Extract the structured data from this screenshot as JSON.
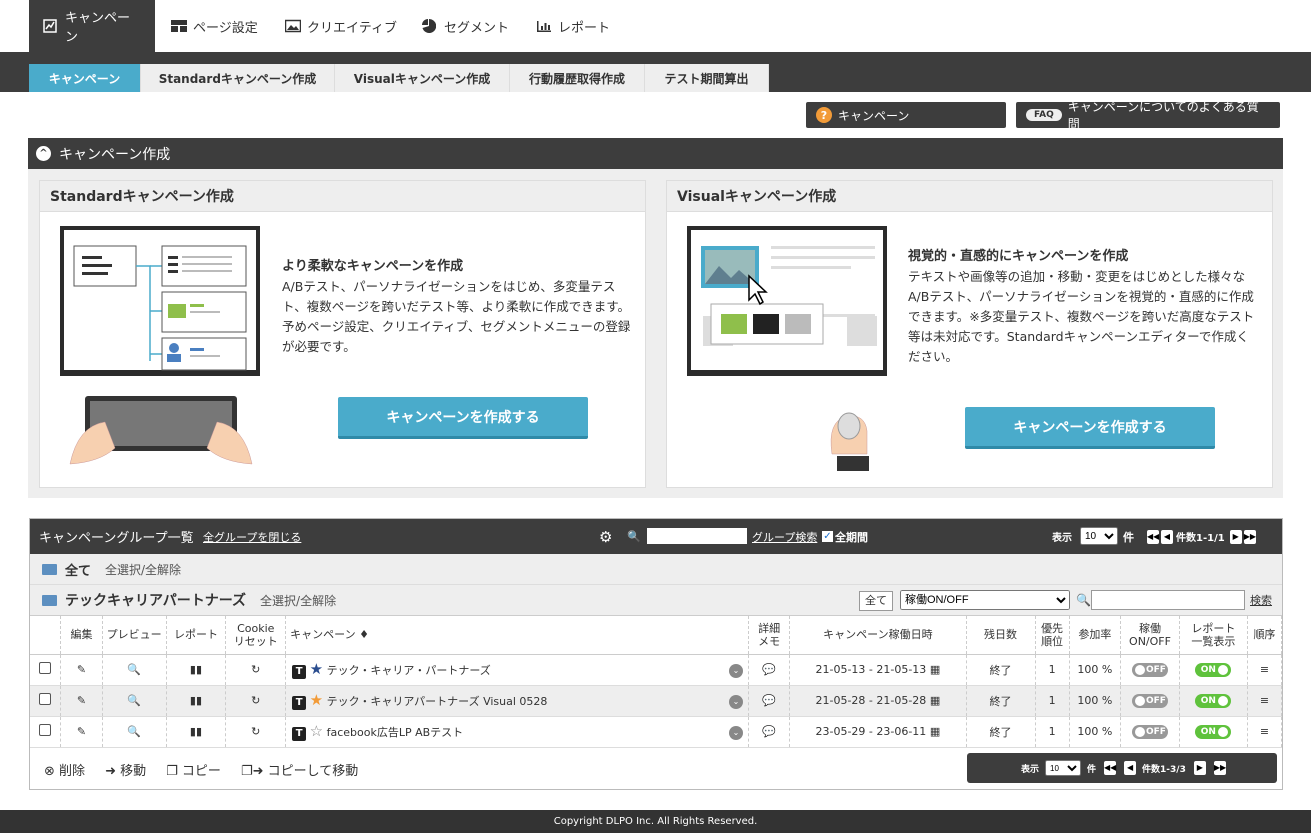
{
  "topnav": {
    "tabs": [
      {
        "label": "キャンペーン",
        "icon": "campaign-icon"
      },
      {
        "label": "ページ設定",
        "icon": "layout-icon"
      },
      {
        "label": "クリエイティブ",
        "icon": "image-icon"
      },
      {
        "label": "セグメント",
        "icon": "pie-chart-icon"
      },
      {
        "label": "レポート",
        "icon": "bar-chart-icon"
      }
    ]
  },
  "subnav": {
    "tabs": [
      "キャンペーン",
      "Standardキャンペーン作成",
      "Visualキャンペーン作成",
      "行動履歴取得作成",
      "テスト期間算出"
    ]
  },
  "help": {
    "campaign_label": "キャンペーン",
    "faq_badge": "FAQ",
    "faq_label": "キャンペーンについてのよくある質問"
  },
  "create_section": {
    "title": "キャンペーン作成",
    "standard": {
      "title": "Standardキャンペーン作成",
      "heading": "より柔軟なキャンペーンを作成",
      "body": "A/Bテスト、パーソナライゼーションをはじめ、多変量テスト、複数ページを跨いだテスト等、より柔軟に作成できます。予めページ設定、クリエイティブ、セグメントメニューの登録が必要です。",
      "button": "キャンペーンを作成する"
    },
    "visual": {
      "title": "Visualキャンペーン作成",
      "heading": "視覚的・直感的にキャンペーンを作成",
      "body": "テキストや画像等の追加・移動・変更をはじめとした様々なA/Bテスト、パーソナライゼーションを視覚的・直感的に作成できます。※多変量テスト、複数ページを跨いだ高度なテスト等は未対応です。Standardキャンペーンエディターで作成ください。",
      "button": "キャンペーンを作成する"
    }
  },
  "group_list": {
    "title": "キャンペーングループ一覧",
    "close_all": "全グループを閉じる",
    "group_search": "グループ検索",
    "all_period": "全期間",
    "display_label": "表示",
    "per_page": "10",
    "unit": "件",
    "count_text": "件数1-1/1",
    "all_row": {
      "label": "全て",
      "select": "全選択/全解除"
    },
    "group": {
      "name": "テックキャリアパートナーズ",
      "select": "全選択/全解除",
      "filter_all": "全て",
      "filter_select": "稼働ON/OFF",
      "search": "検索"
    },
    "columns": [
      "編集",
      "プレビュー",
      "レポート",
      "Cookie\nリセット",
      "キャンペーン ♦",
      "詳細\nメモ",
      "キャンペーン稼働日時",
      "残日数",
      "優先\n順位",
      "参加率",
      "稼働\nON/OFF",
      "レポート\n一覧表示",
      "順序"
    ],
    "rows": [
      {
        "name": "テック・キャリア・パートナーズ",
        "star": "★",
        "star_color": "#2a4d8f",
        "period": "21-05-13 - 21-05-13",
        "remaining": "終了",
        "priority": "1",
        "rate": "100 %",
        "status": "OFF",
        "report": "ON"
      },
      {
        "name": "テック・キャリアパートナーズ Visual 0528",
        "star": "★",
        "star_color": "#f29b38",
        "period": "21-05-28 - 21-05-28",
        "remaining": "終了",
        "priority": "1",
        "rate": "100 %",
        "status": "OFF",
        "report": "ON"
      },
      {
        "name": "facebook広告LP ABテスト",
        "star": "☆",
        "star_color": "#888888",
        "period": "23-05-29 - 23-06-11",
        "remaining": "終了",
        "priority": "1",
        "rate": "100 %",
        "status": "OFF",
        "report": "ON"
      }
    ],
    "actions": [
      "削除",
      "移動",
      "コピー",
      "コピーして移動"
    ],
    "bottom_pager": {
      "display_label": "表示",
      "per_page": "10",
      "unit": "件",
      "count_text": "件数1-3/3"
    }
  },
  "footer": "Copyright DLPO Inc. All Rights Reserved.",
  "colors": {
    "dark": "#3d3d3d",
    "accent": "#4aabcb",
    "on": "#5fc23c",
    "off": "#999999"
  }
}
